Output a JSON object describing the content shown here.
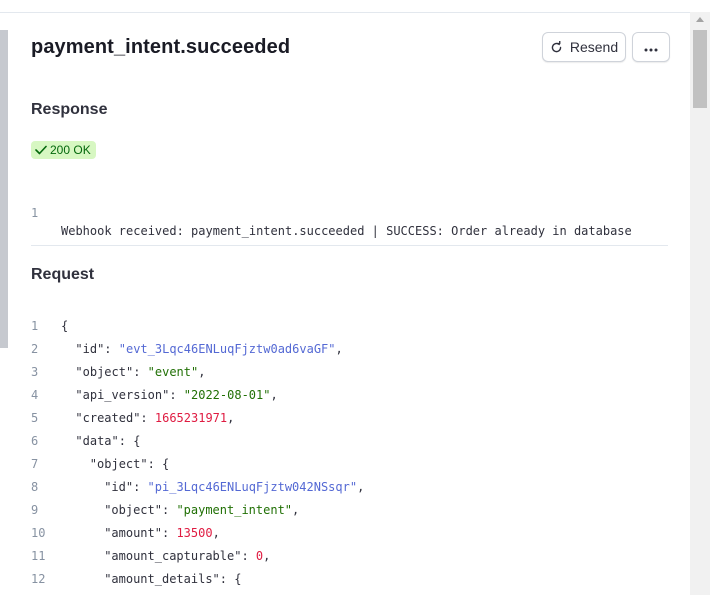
{
  "header": {
    "title": "payment_intent.succeeded",
    "resend_label": "Resend",
    "more_label": "⋯"
  },
  "response": {
    "heading": "Response",
    "status_badge": "200 OK",
    "body_lines": [
      {
        "num": "1",
        "text": "Webhook received: payment_intent.succeeded | SUCCESS: Order already in database"
      }
    ]
  },
  "request": {
    "heading": "Request",
    "lines": [
      {
        "num": "1",
        "indent": 0,
        "parts": [
          {
            "t": "p",
            "v": "{"
          }
        ]
      },
      {
        "num": "2",
        "indent": 1,
        "parts": [
          {
            "t": "k",
            "v": "\"id\""
          },
          {
            "t": "p",
            "v": ": "
          },
          {
            "t": "s",
            "v": "\"evt_3Lqc46ENLuqFjztw0ad6vaGF\""
          },
          {
            "t": "p",
            "v": ","
          }
        ]
      },
      {
        "num": "3",
        "indent": 1,
        "parts": [
          {
            "t": "k",
            "v": "\"object\""
          },
          {
            "t": "p",
            "v": ": "
          },
          {
            "t": "sg",
            "v": "\"event\""
          },
          {
            "t": "p",
            "v": ","
          }
        ]
      },
      {
        "num": "4",
        "indent": 1,
        "parts": [
          {
            "t": "k",
            "v": "\"api_version\""
          },
          {
            "t": "p",
            "v": ": "
          },
          {
            "t": "sg",
            "v": "\"2022-08-01\""
          },
          {
            "t": "p",
            "v": ","
          }
        ]
      },
      {
        "num": "5",
        "indent": 1,
        "parts": [
          {
            "t": "k",
            "v": "\"created\""
          },
          {
            "t": "p",
            "v": ": "
          },
          {
            "t": "n",
            "v": "1665231971"
          },
          {
            "t": "p",
            "v": ","
          }
        ]
      },
      {
        "num": "6",
        "indent": 1,
        "parts": [
          {
            "t": "k",
            "v": "\"data\""
          },
          {
            "t": "p",
            "v": ": {"
          }
        ]
      },
      {
        "num": "7",
        "indent": 2,
        "parts": [
          {
            "t": "k",
            "v": "\"object\""
          },
          {
            "t": "p",
            "v": ": {"
          }
        ]
      },
      {
        "num": "8",
        "indent": 3,
        "parts": [
          {
            "t": "k",
            "v": "\"id\""
          },
          {
            "t": "p",
            "v": ": "
          },
          {
            "t": "s",
            "v": "\"pi_3Lqc46ENLuqFjztw042NSsqr\""
          },
          {
            "t": "p",
            "v": ","
          }
        ]
      },
      {
        "num": "9",
        "indent": 3,
        "parts": [
          {
            "t": "k",
            "v": "\"object\""
          },
          {
            "t": "p",
            "v": ": "
          },
          {
            "t": "sg",
            "v": "\"payment_intent\""
          },
          {
            "t": "p",
            "v": ","
          }
        ]
      },
      {
        "num": "10",
        "indent": 3,
        "parts": [
          {
            "t": "k",
            "v": "\"amount\""
          },
          {
            "t": "p",
            "v": ": "
          },
          {
            "t": "n",
            "v": "13500"
          },
          {
            "t": "p",
            "v": ","
          }
        ]
      },
      {
        "num": "11",
        "indent": 3,
        "parts": [
          {
            "t": "k",
            "v": "\"amount_capturable\""
          },
          {
            "t": "p",
            "v": ": "
          },
          {
            "t": "n",
            "v": "0"
          },
          {
            "t": "p",
            "v": ","
          }
        ]
      },
      {
        "num": "12",
        "indent": 3,
        "parts": [
          {
            "t": "k",
            "v": "\"amount_details\""
          },
          {
            "t": "p",
            "v": ": {"
          }
        ]
      }
    ]
  },
  "icons": {
    "resend": "refresh-icon",
    "status": "check-icon"
  },
  "colors": {
    "string_blue": "#5469d4",
    "string_green": "#217005",
    "number_red": "#df1b41",
    "badge_bg": "#d7f7c2",
    "badge_text": "#05690d"
  }
}
